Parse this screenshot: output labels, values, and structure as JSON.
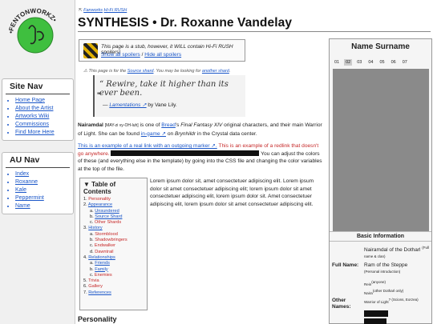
{
  "logo": {
    "text": "•FENTONWORKZ•"
  },
  "sidebar": {
    "site_nav": {
      "title": "Site Nav",
      "items": [
        {
          "label": "Home Page"
        },
        {
          "label": "About the Artist"
        },
        {
          "label": "Artworks Wiki"
        },
        {
          "label": "Commissions"
        },
        {
          "label": "Find More Here"
        }
      ]
    },
    "au_nav": {
      "title": "AU Nav",
      "items": [
        {
          "label": "Index"
        },
        {
          "label": "Roxanne"
        },
        {
          "label": "Kale"
        },
        {
          "label": "Peppermint"
        },
        {
          "label": "Name"
        }
      ]
    }
  },
  "breadcrumb": {
    "prefix": "⇱",
    "link1": "Fanworks",
    "link2": "Hi-Fi RUSH"
  },
  "page_title": "SYNTHESIS • Dr. Roxanne Vandelay",
  "stub": {
    "line1": "This page is a stub, however, it WILL contain Hi-Fi RUSH spoilers!",
    "show_all": "Show all spoilers",
    "sep": " / ",
    "hide_all": "Hide all spoilers"
  },
  "shard_note": {
    "prefix": "⚠ This page is for the ",
    "link": "Source shard",
    "middle": ". You may be looking for ",
    "link2": "another shard",
    "suffix": "."
  },
  "quote": {
    "text": "Rewire, take it higher than its ever been.",
    "mark": "\"",
    "source_prefix": "— ",
    "source_link": "Lamentations ↗",
    "source_suffix": " by Vane Lily."
  },
  "intro": {
    "name": "Nairamdal",
    "pron": "[MAY-zi vy-OH-luh]",
    "t1": " is one of ",
    "link1": "Bread",
    "t2": "'s ",
    "game": "Final Fantasy XIV",
    "t3": " original characters, and their main Warrior of Light. She can be found ",
    "link2": "in-game ↗",
    "t4": " on ",
    "server": "Brynhildr",
    "t5": " in the Crystal data center."
  },
  "example": {
    "link_text": "This is an example of a real link with an outgoing marker ↗.",
    "red_text": " This is an example of a redlink that doesn't go anywhere.",
    "t1": " You can adjust the colors of these (and everything else in the template) by going into the CSS file and changing the color variables at the top of the file."
  },
  "toc": {
    "title": "▼ Table of Contents",
    "items": [
      {
        "num": "1.",
        "label": "Personality",
        "cls": "red"
      },
      {
        "num": "2.",
        "label": "Appearance",
        "cls": "blue"
      },
      {
        "num": "a.",
        "label": "Unsundered",
        "cls": "blue",
        "sub": true
      },
      {
        "num": "b.",
        "label": "Source Shard",
        "cls": "blue",
        "sub": true
      },
      {
        "num": "c.",
        "label": "Other Shards",
        "cls": "red",
        "sub": true
      },
      {
        "num": "3.",
        "label": "History",
        "cls": "blue"
      },
      {
        "num": "a.",
        "label": "Stormblood",
        "cls": "red",
        "sub": true
      },
      {
        "num": "b.",
        "label": "Shadowbringers",
        "cls": "red",
        "sub": true
      },
      {
        "num": "c.",
        "label": "Endwalker",
        "cls": "red",
        "sub": true
      },
      {
        "num": "d.",
        "label": "Dawntrail",
        "cls": "red",
        "sub": true
      },
      {
        "num": "4.",
        "label": "Relationships",
        "cls": "blue"
      },
      {
        "num": "a.",
        "label": "Friends",
        "cls": "blue",
        "sub": true
      },
      {
        "num": "b.",
        "label": "Family",
        "cls": "blue",
        "sub": true
      },
      {
        "num": "c.",
        "label": "Enemies",
        "cls": "red",
        "sub": true
      },
      {
        "num": "5.",
        "label": "Trivia",
        "cls": "red"
      },
      {
        "num": "6.",
        "label": "Gallery",
        "cls": "red"
      },
      {
        "num": "7.",
        "label": "References",
        "cls": "blue"
      }
    ]
  },
  "lorem": "Lorem ipsum dolor sit, amet consectetuer adipiscing elit. Lorem ipsum dolor sit amet consectetuer adipiscing elit; lorem ipsum dolor sit amet consectetuer adipiscing elit, lorem ipsum dolor sit. Amet consectetuer adipiscing elit, lorem ipsum dolor sit amet consectetuer adipiscing elit.",
  "section_heading": "Personality",
  "infobox": {
    "title": "Name Surname",
    "tabs": [
      "01",
      "02",
      "03",
      "04",
      "05",
      "06",
      "07"
    ],
    "active_tab": "02",
    "basic_title": "Basic Information",
    "full_name_label": "Full Name:",
    "full_name_1": "Nairamdal of the Dotharl",
    "full_name_1_note": "(Full name & clan)",
    "full_name_2": "Ram of the Steppe",
    "full_name_2_note": "(Personal introduction)",
    "other_names_label": "Other Names:",
    "other_1": "Rein",
    "other_1_note": "(anyone)",
    "other_2": "Naira",
    "other_2_note": "(other Dotharl only)",
    "other_3": "Warrior of Light",
    "other_3_note": "? (Scions, Eorzea)"
  },
  "colors": {
    "link": "#1a56c8",
    "redlink": "#c62828",
    "logo_green": "#3fbf3f"
  }
}
